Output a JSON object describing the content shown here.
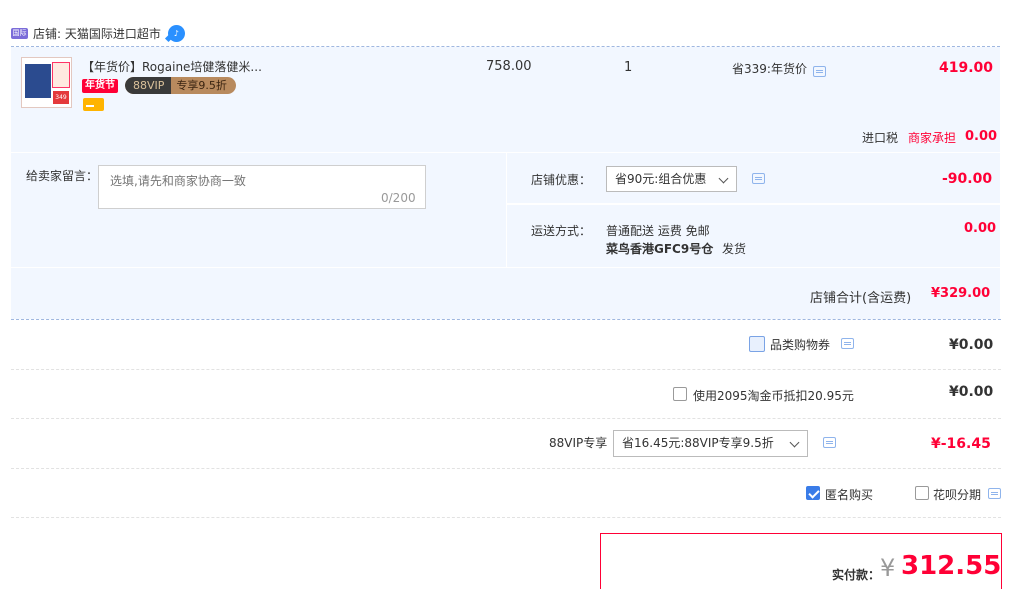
{
  "store": {
    "label": "店铺: 天猫国际进口超市",
    "logo_icon": "tmall-global-icon",
    "chat_icon": "wangwang-chat-icon"
  },
  "product": {
    "title": "【年货价】Rogaine培健落健米...",
    "tag_festival": "年货节",
    "tag_vip_left": "88VIP",
    "tag_vip_right": "专享9.5折",
    "unit_price": "758.00",
    "quantity": "1",
    "saving": "省339:年货价",
    "total": "419.00",
    "thumb_badge": "349"
  },
  "tax": {
    "label": "进口税",
    "merchant": "商家承担",
    "value": "0.00"
  },
  "message": {
    "label": "给卖家留言：",
    "placeholder": "选填,请先和商家协商一致",
    "count": "0/200"
  },
  "store_discount": {
    "label": "店铺优惠：",
    "selected": "省90元:组合优惠",
    "value": "-90.00"
  },
  "shipping": {
    "label": "运送方式：",
    "method": "普通配送 运费 免邮",
    "warehouse": "菜鸟香港GFC9号仓",
    "send": "发货",
    "value": "0.00"
  },
  "subtotal": {
    "label": "店铺合计(含运费)",
    "value": "¥329.00"
  },
  "coupon": {
    "label": "品类购物券",
    "value": "¥0.00"
  },
  "taojinbi": {
    "label": "使用2095淘金币抵扣20.95元",
    "value": "¥0.00"
  },
  "vip_discount": {
    "label": "88VIP专享",
    "selected": "省16.45元:88VIP专享9.5折",
    "value": "¥-16.45"
  },
  "options": {
    "anonymous": "匿名购买",
    "anonymous_checked": true,
    "huabei": "花呗分期",
    "huabei_checked": false
  },
  "payment": {
    "label": "实付款：",
    "currency": "¥",
    "amount": "312.55"
  },
  "colors": {
    "accent_red": "#ff0036",
    "panel_blue": "#f2f7ff",
    "checkbox_blue": "#3a7ce8"
  }
}
